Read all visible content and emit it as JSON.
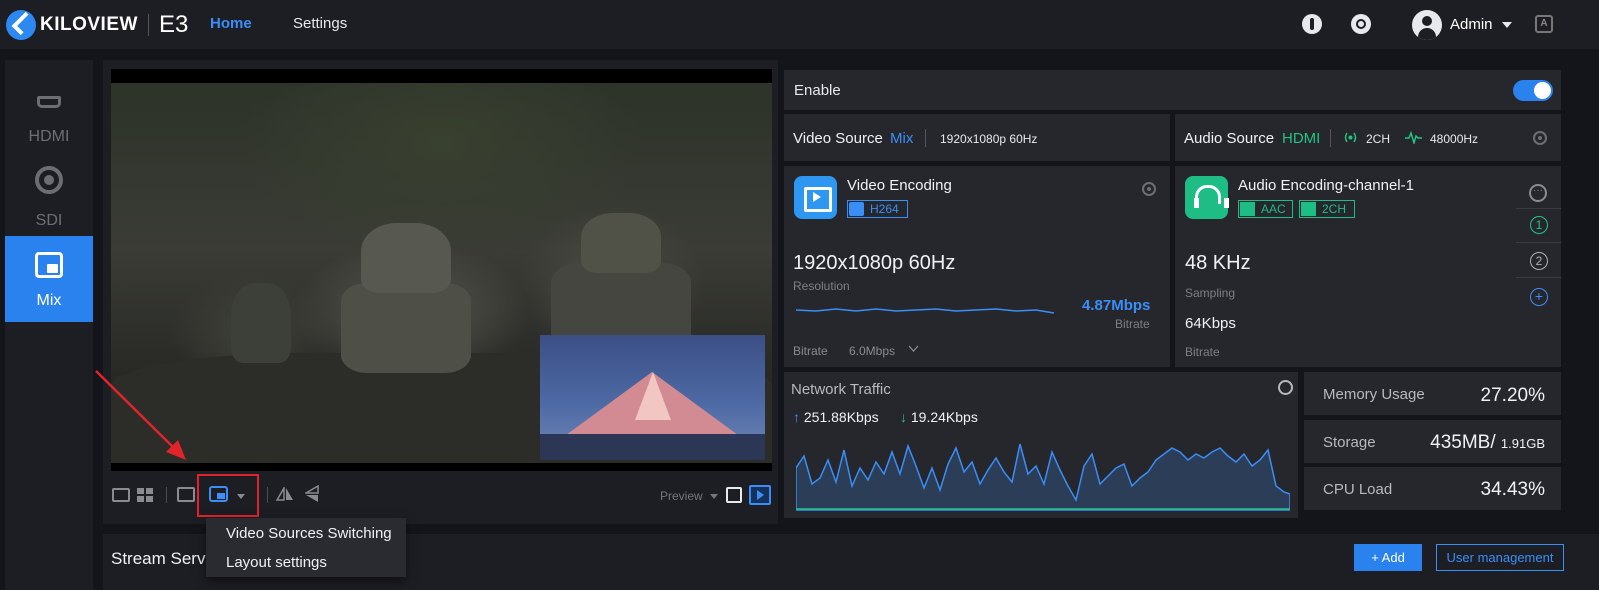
{
  "header": {
    "logo_text": "KILOVIEW",
    "product": "E3",
    "nav_home": "Home",
    "nav_settings": "Settings",
    "user": "Admin",
    "lang_badge": "A"
  },
  "sidebar": {
    "items": [
      {
        "label": "HDMI"
      },
      {
        "label": "SDI"
      },
      {
        "label": "Mix"
      }
    ]
  },
  "preview": {
    "mode_label": "Preview"
  },
  "dropdown": {
    "items": [
      "Video Sources Switching",
      "Layout settings"
    ]
  },
  "stream": {
    "title": "Stream Servi",
    "add_label": "+ Add",
    "user_mgmt_label": "User management"
  },
  "enable": {
    "label": "Enable",
    "on": true
  },
  "video_source": {
    "label": "Video Source",
    "value": "Mix",
    "format": "1920x1080p 60Hz"
  },
  "audio_source": {
    "label": "Audio Source",
    "value": "HDMI",
    "channels": "2CH",
    "rate": "48000Hz"
  },
  "video_encoding": {
    "title": "Video Encoding",
    "codec": "H264",
    "resolution": "1920x1080p 60Hz",
    "resolution_label": "Resolution",
    "bitrate_value": "4.87Mbps",
    "bitrate_label": "Bitrate",
    "bitrate_setting_label": "Bitrate",
    "bitrate_setting": "6.0Mbps"
  },
  "audio_encoding": {
    "title": "Audio Encoding-channel-1",
    "codec": "AAC",
    "channels": "2CH",
    "sampling": "48 KHz",
    "sampling_label": "Sampling",
    "bitrate": "64Kbps",
    "bitrate_label": "Bitrate"
  },
  "channels": {
    "menu": "···",
    "ch1": "1",
    "ch2": "2",
    "add": "+"
  },
  "network": {
    "title": "Network Traffic",
    "up": "251.88Kbps",
    "down": "19.24Kbps"
  },
  "stats": {
    "memory_label": "Memory Usage",
    "memory_value": "27.20%",
    "storage_label": "Storage",
    "storage_used": "435MB/",
    "storage_total": "1.91GB",
    "cpu_label": "CPU Load",
    "cpu_value": "34.43%"
  },
  "colors": {
    "accent": "#2a82ee",
    "green": "#1fbd86",
    "highlight_red": "#e0242a"
  }
}
